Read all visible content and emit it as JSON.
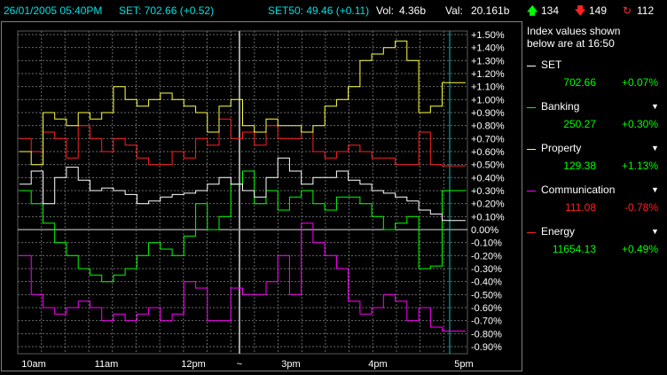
{
  "topbar": {
    "datetime": "26/01/2005 05:40PM",
    "set_text": "SET: 702.66 (+0.52)",
    "set50_text": "SET50: 49.46 (+0.11)",
    "vol_label": "Vol:",
    "vol_value": "4.36b",
    "val_label": "Val:",
    "val_value": "20.161b",
    "up_count": "134",
    "down_count": "149",
    "unchanged_count": "112",
    "up_icon": "up-arrow-icon",
    "down_icon": "down-arrow-icon",
    "unchanged_icon": "refresh-icon"
  },
  "panel": {
    "header_line1": "Index values shown",
    "header_line2": "below are at 16:50",
    "series": [
      {
        "name": "SET",
        "value": "702.66",
        "change": "+0.07%",
        "color": "#ffffff",
        "change_color": "green"
      },
      {
        "name": "Banking",
        "value": "250.27",
        "change": "+0.30%",
        "color": "#00ff00",
        "change_color": "green"
      },
      {
        "name": "Property",
        "value": "129.38",
        "change": "+1.13%",
        "color": "#ffff40",
        "change_color": "green"
      },
      {
        "name": "Communication",
        "value": "111.08",
        "change": "-0.78%",
        "color": "#ff00ff",
        "change_color": "red"
      },
      {
        "name": "Energy",
        "value": "11654.13",
        "change": "+0.49%",
        "color": "#ff2020",
        "change_color": "green"
      }
    ]
  },
  "chart_data": {
    "type": "line",
    "x_ticks": [
      "10am",
      "11am",
      "12pm",
      "~",
      "3pm",
      "4pm",
      "5pm"
    ],
    "y_ticks": [
      "+1.50%",
      "+1.40%",
      "+1.30%",
      "+1.20%",
      "+1.10%",
      "+1.00%",
      "+0.90%",
      "+0.80%",
      "+0.70%",
      "+0.60%",
      "+0.50%",
      "+0.40%",
      "+0.30%",
      "+0.20%",
      "+0.10%",
      "0.00%",
      "-0.10%",
      "-0.20%",
      "-0.30%",
      "-0.40%",
      "-0.50%",
      "-0.60%",
      "-0.70%",
      "-0.80%",
      "-0.90%"
    ],
    "ylim": [
      -0.9,
      1.5
    ],
    "grid": true,
    "series": [
      {
        "name": "SET",
        "color": "#ffffff",
        "values": [
          0.35,
          0.45,
          0.2,
          0.4,
          0.48,
          0.38,
          0.3,
          0.32,
          0.3,
          0.27,
          0.2,
          0.22,
          0.25,
          0.27,
          0.28,
          0.3,
          0.35,
          0.4,
          0.35,
          0.3,
          0.25,
          0.4,
          0.55,
          0.45,
          0.35,
          0.4,
          0.4,
          0.45,
          0.38,
          0.35,
          0.3,
          0.28,
          0.25,
          0.22,
          0.15,
          0.12,
          0.07,
          0.07
        ]
      },
      {
        "name": "Banking",
        "color": "#00ff00",
        "values": [
          0.3,
          0.2,
          0.05,
          -0.1,
          -0.2,
          -0.3,
          -0.35,
          -0.4,
          -0.35,
          -0.3,
          -0.2,
          -0.1,
          -0.15,
          -0.2,
          -0.05,
          0.2,
          0.0,
          0.1,
          0.35,
          0.45,
          0.2,
          0.3,
          0.15,
          0.25,
          0.3,
          0.2,
          0.15,
          0.25,
          0.25,
          0.2,
          0.1,
          0.0,
          0.05,
          0.1,
          -0.3,
          -0.28,
          0.3,
          0.3
        ]
      },
      {
        "name": "Property",
        "color": "#ffff40",
        "values": [
          0.6,
          0.5,
          0.9,
          0.85,
          0.8,
          0.9,
          0.85,
          0.9,
          1.1,
          1.0,
          0.95,
          1.0,
          1.05,
          1.0,
          0.95,
          0.9,
          0.75,
          0.95,
          1.0,
          0.8,
          0.75,
          0.85,
          0.8,
          0.8,
          0.75,
          0.8,
          0.95,
          1.0,
          1.1,
          1.3,
          1.35,
          1.4,
          1.45,
          1.3,
          0.9,
          0.95,
          1.13,
          1.13
        ]
      },
      {
        "name": "Communication",
        "color": "#ff00ff",
        "values": [
          -0.2,
          -0.5,
          -0.6,
          -0.65,
          -0.6,
          -0.55,
          -0.6,
          -0.7,
          -0.65,
          -0.7,
          -0.65,
          -0.6,
          -0.7,
          -0.65,
          -0.4,
          -0.45,
          -0.7,
          -0.7,
          -0.45,
          -0.5,
          -0.5,
          -0.4,
          -0.2,
          -0.5,
          0.05,
          -0.1,
          -0.2,
          -0.3,
          -0.55,
          -0.65,
          -0.6,
          -0.5,
          -0.55,
          -0.7,
          -0.6,
          -0.75,
          -0.78,
          -0.78
        ]
      },
      {
        "name": "Energy",
        "color": "#ff2020",
        "values": [
          0.7,
          0.6,
          0.75,
          0.7,
          0.55,
          0.8,
          0.7,
          0.6,
          0.7,
          0.65,
          0.55,
          0.5,
          0.5,
          0.6,
          0.55,
          0.7,
          0.65,
          0.85,
          0.7,
          0.75,
          0.65,
          0.8,
          0.7,
          0.7,
          0.75,
          0.6,
          0.55,
          0.6,
          0.65,
          0.6,
          0.55,
          0.55,
          0.5,
          0.5,
          0.75,
          0.5,
          0.49,
          0.49
        ]
      }
    ]
  }
}
